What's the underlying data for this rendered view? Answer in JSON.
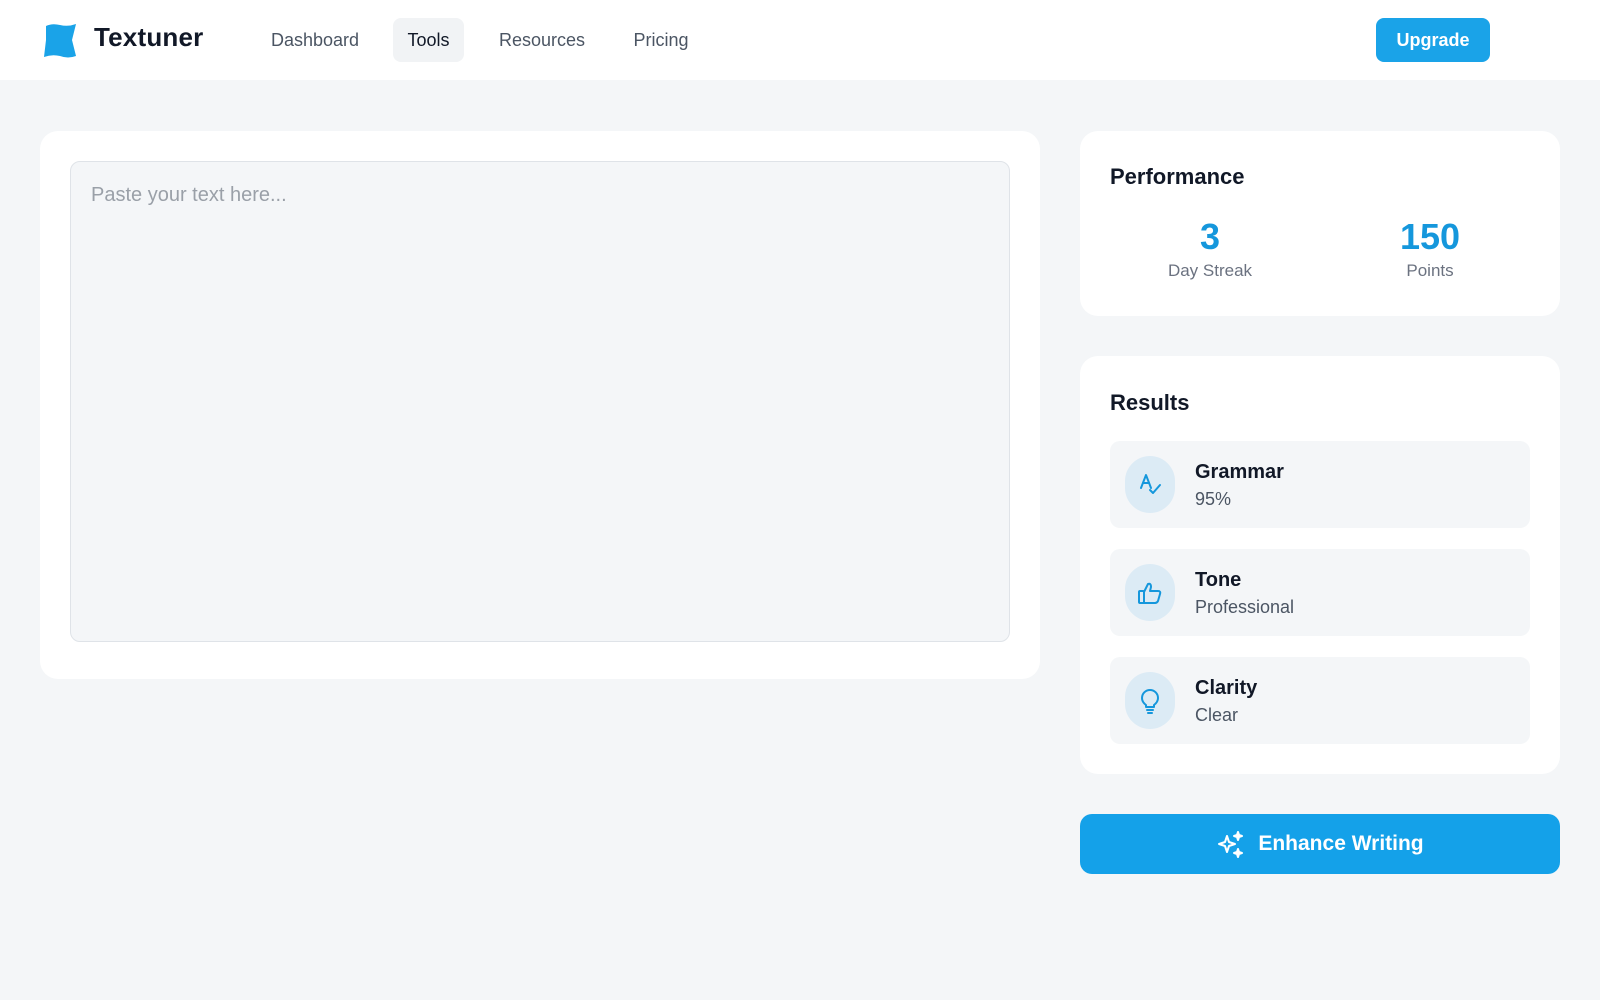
{
  "brand": {
    "name": "Textuner",
    "accent_color": "#1aa3e8"
  },
  "nav": {
    "items": [
      {
        "label": "Dashboard",
        "active": false
      },
      {
        "label": "Tools",
        "active": true
      },
      {
        "label": "Resources",
        "active": false
      },
      {
        "label": "Pricing",
        "active": false
      }
    ],
    "upgrade_label": "Upgrade"
  },
  "editor": {
    "placeholder": "Paste your text here...",
    "value": ""
  },
  "performance": {
    "title": "Performance",
    "stats": [
      {
        "value": "3",
        "label": "Day Streak"
      },
      {
        "value": "150",
        "label": "Points"
      }
    ]
  },
  "results": {
    "title": "Results",
    "items": [
      {
        "icon": "spellcheck-icon",
        "label": "Grammar",
        "value": "95%"
      },
      {
        "icon": "thumbs-up-icon",
        "label": "Tone",
        "value": "Professional"
      },
      {
        "icon": "lightbulb-icon",
        "label": "Clarity",
        "value": "Clear"
      }
    ]
  },
  "actions": {
    "enhance_label": "Enhance Writing",
    "enhance_icon": "sparkles-icon"
  }
}
